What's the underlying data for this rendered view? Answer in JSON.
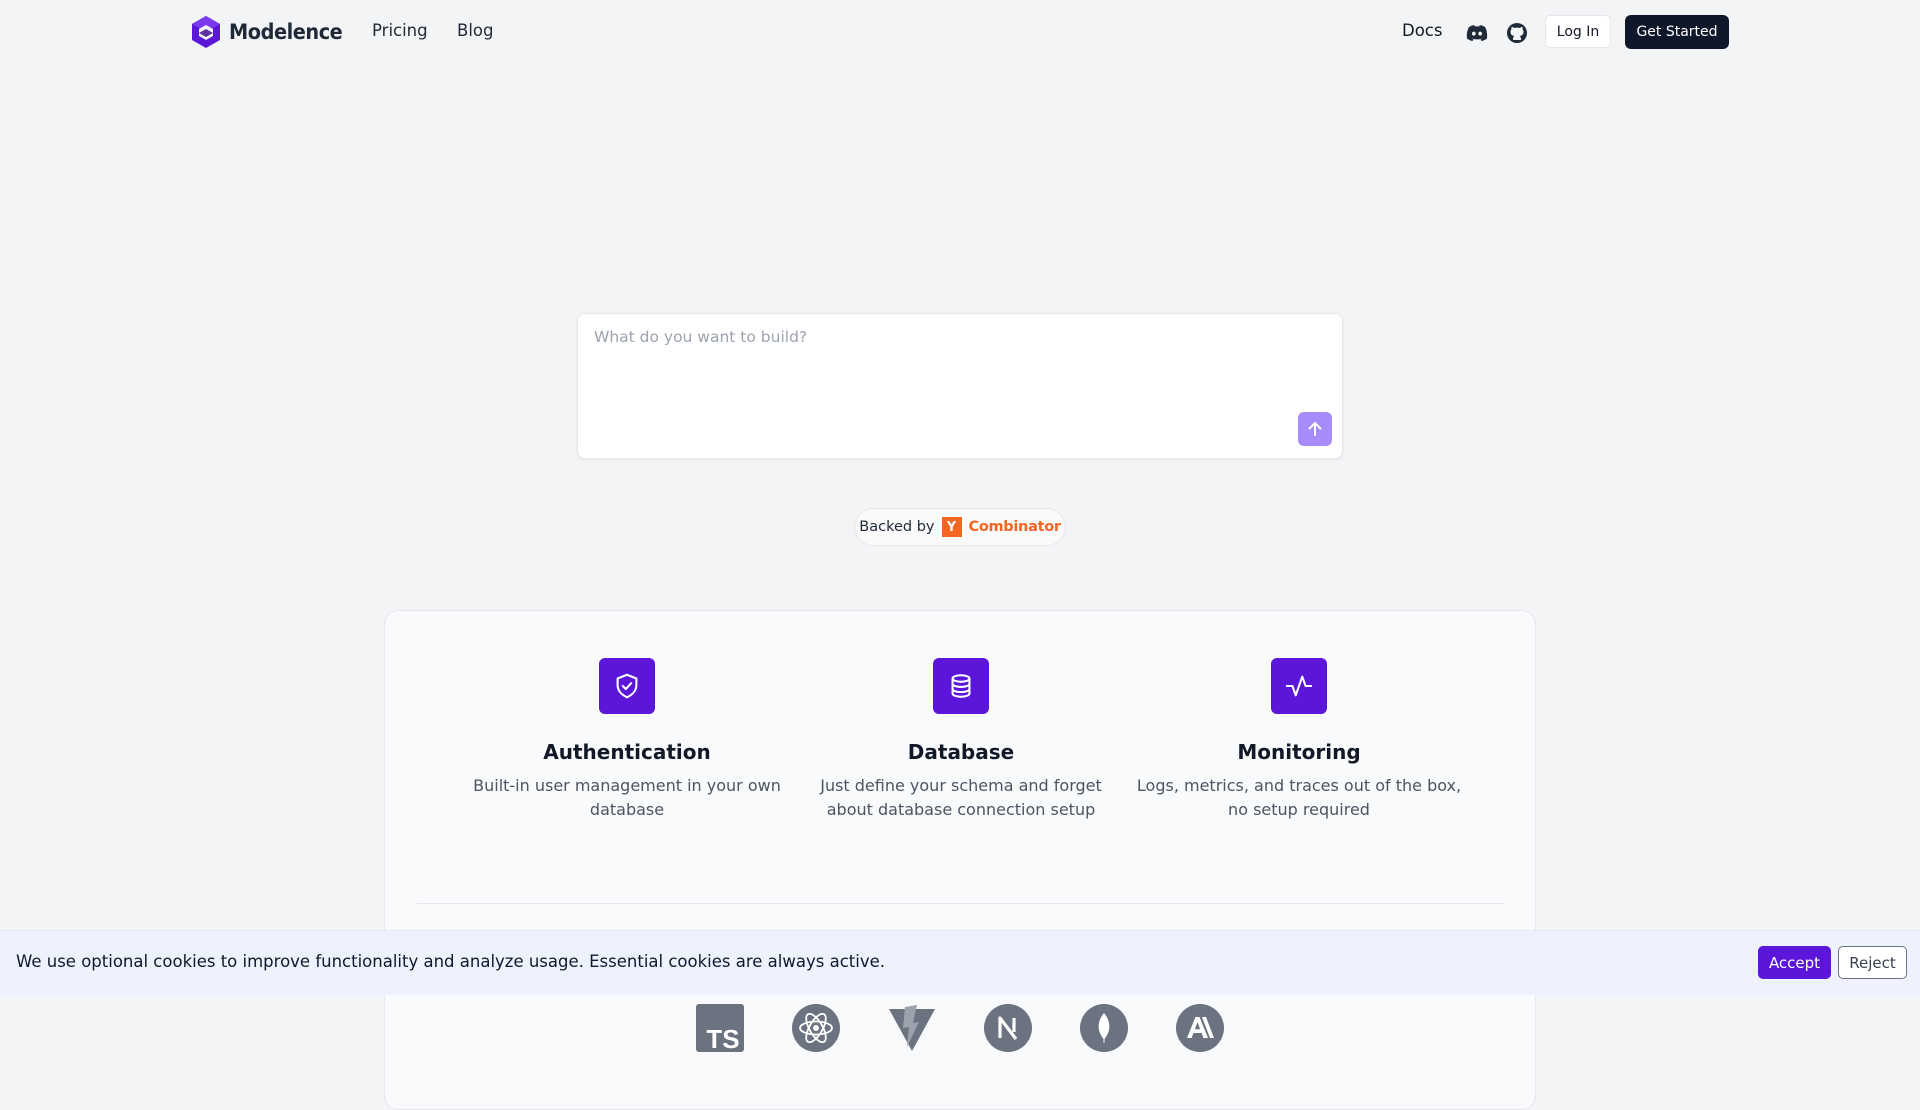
{
  "nav": {
    "brand": "Modelence",
    "links": [
      "Pricing",
      "Blog"
    ],
    "docs": "Docs",
    "discord_icon": "discord-icon",
    "github_icon": "github-icon",
    "login": "Log In",
    "get_started": "Get Started"
  },
  "prompt": {
    "placeholder": "What do you want to build?",
    "send_icon": "arrow-up-icon"
  },
  "backed": {
    "label": "Backed by",
    "yc_letter": "Y",
    "yc_name": "Combinator"
  },
  "features": [
    {
      "icon": "shield-check-icon",
      "title": "Authentication",
      "desc": "Built-in user management in your own database"
    },
    {
      "icon": "database-icon",
      "title": "Database",
      "desc": "Just define your schema and forget about database connection setup"
    },
    {
      "icon": "activity-icon",
      "title": "Monitoring",
      "desc": "Logs, metrics, and traces out of the box, no setup required"
    }
  ],
  "tech": {
    "ts_label": "TS",
    "logos": [
      "typescript-icon",
      "react-icon",
      "vite-icon",
      "nextjs-icon",
      "mongodb-icon",
      "anthropic-icon"
    ]
  },
  "cookie": {
    "text": "We use optional cookies to improve functionality and analyze usage. Essential cookies are always active.",
    "accept": "Accept",
    "reject": "Reject"
  },
  "colors": {
    "accent": "#5b16d9",
    "send_button": "#a78bfa",
    "dark_button": "#0f172a",
    "yc_orange": "#f26522",
    "background": "#f3f4f6",
    "cookie_bar": "#eef2ff"
  }
}
